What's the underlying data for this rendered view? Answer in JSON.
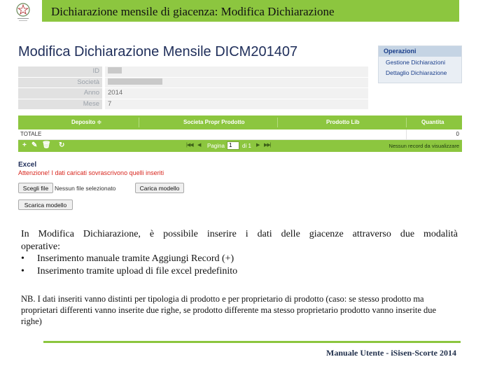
{
  "slide": {
    "title": "Dichiarazione mensile di giacenza: Modifica Dichiarazione",
    "footer": "Manuale Utente - iSisen-Scorte 2014"
  },
  "screen": {
    "heading": "Modifica Dichiarazione Mensile DICM201407",
    "fields": [
      {
        "label": "ID",
        "value": "",
        "redacted": true
      },
      {
        "label": "Società",
        "value": "",
        "redacted": true
      },
      {
        "label": "Anno",
        "value": "2014",
        "redacted": false
      },
      {
        "label": "Mese",
        "value": "7",
        "redacted": false
      }
    ],
    "side_panel": {
      "title": "Operazioni",
      "items": [
        "Gestione Dichiarazioni",
        "Dettaglio Dichiarazione"
      ]
    },
    "grid": {
      "columns": [
        "Deposito ≑",
        "Societa Propr Prodotto",
        "Prodotto Lib",
        "Quantita"
      ],
      "total_label": "TOTALE",
      "total_value": "0",
      "pager": {
        "page_label": "Pagina",
        "page_value": "1",
        "of_label": "di 1",
        "records": "Nessun record da visualizzare"
      }
    },
    "excel": {
      "title": "Excel",
      "warning": "Attenzione! I dati caricati sovrascrivono quelli inseriti",
      "choose_button": "Scegli file",
      "no_file": "Nessun file selezionato",
      "upload_button": "Carica modello",
      "download_button": "Scarica modello"
    }
  },
  "description": {
    "intro": "In Modifica Dichiarazione, è possibile inserire i dati delle giacenze attraverso due modalità",
    "intro_cont": "operative:",
    "bullets": [
      "Inserimento manuale tramite Aggiungi Record (+)",
      "Inserimento tramite upload di file excel predefinito"
    ],
    "note": "NB. I dati inseriti vanno distinti per tipologia di prodotto e per proprietario di prodotto (caso: se stesso prodotto ma proprietari differenti vanno inserite due righe, se prodotto differente ma stesso proprietario prodotto vanno inserite due righe)"
  },
  "colors": {
    "accent_green": "#8cc63f",
    "warning_red": "#d8261e",
    "heading_navy": "#1f2e5a"
  },
  "icons": {
    "emblem": "italian-republic-emblem-icon",
    "add": "plus-icon",
    "edit": "pencil-icon",
    "delete": "trash-icon",
    "refresh": "refresh-icon"
  }
}
